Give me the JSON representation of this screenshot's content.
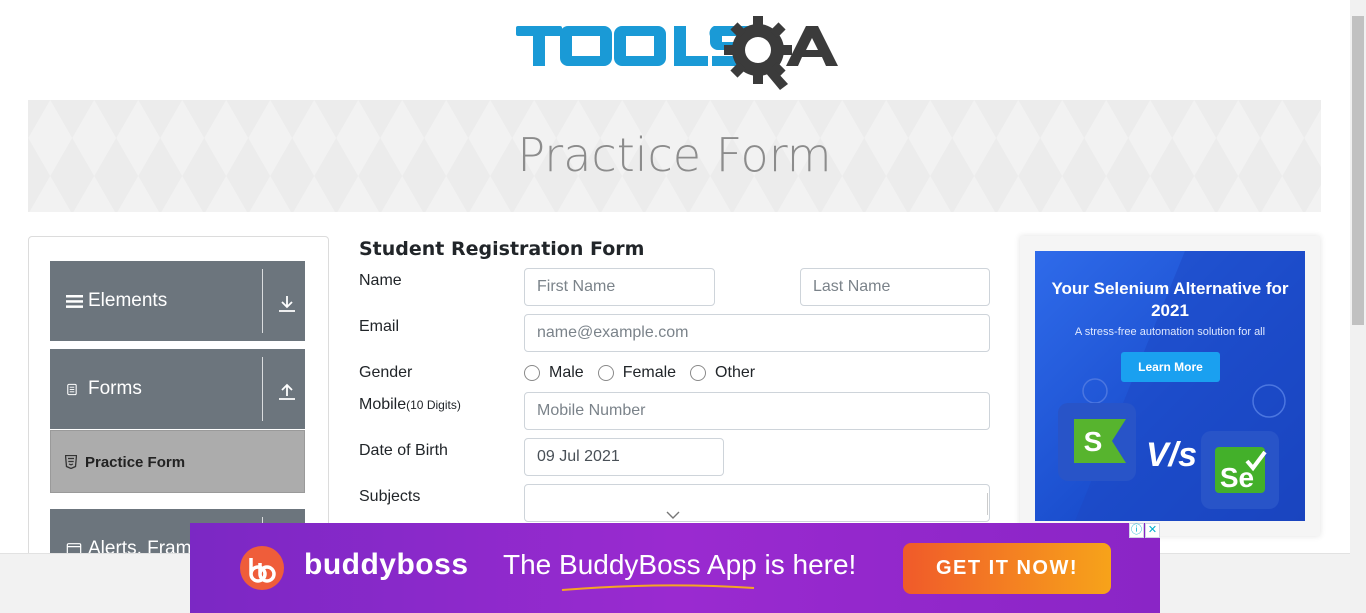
{
  "header": {
    "logo_text": "TOOLSQA",
    "page_title": "Practice Form"
  },
  "sidebar": {
    "groups": [
      {
        "label": "Elements",
        "icon": "list-icon",
        "toggle_icon": "arrow-down-icon"
      },
      {
        "label": "Forms",
        "icon": "document-icon",
        "toggle_icon": "arrow-up-icon"
      },
      {
        "label": "Alerts, Fram",
        "icon": "window-icon",
        "toggle_icon": "arrow-down-icon"
      }
    ],
    "active_item": {
      "label": "Practice Form",
      "icon": "html-icon"
    }
  },
  "form": {
    "title": "Student Registration Form",
    "name_label": "Name",
    "first_name_placeholder": "First Name",
    "last_name_placeholder": "Last Name",
    "email_label": "Email",
    "email_placeholder": "name@example.com",
    "gender_label": "Gender",
    "gender_options": [
      "Male",
      "Female",
      "Other"
    ],
    "mobile_label": "Mobile",
    "mobile_hint": "(10 Digits)",
    "mobile_placeholder": "Mobile Number",
    "dob_label": "Date of Birth",
    "dob_value": "09 Jul 2021",
    "subjects_label": "Subjects"
  },
  "side_ad": {
    "headline": "Your Selenium Alternative for 2021",
    "subline": "A stress-free automation solution for all",
    "button": "Learn More",
    "vs_text": "V/s"
  },
  "bottom_ad": {
    "brand": "buddyboss",
    "tagline": "The BuddyBoss App is here!",
    "cta": "GET IT NOW!",
    "info_icon": "ⓘ",
    "close_icon": "✕"
  },
  "colors": {
    "sidebar_header": "#6c757d",
    "sidebar_active": "#acacac",
    "logo_blue": "#1a9ad6",
    "logo_dark": "#3b3b3b",
    "ad_purple": "#8a25c6",
    "ad_orange": "#f7a31a"
  }
}
